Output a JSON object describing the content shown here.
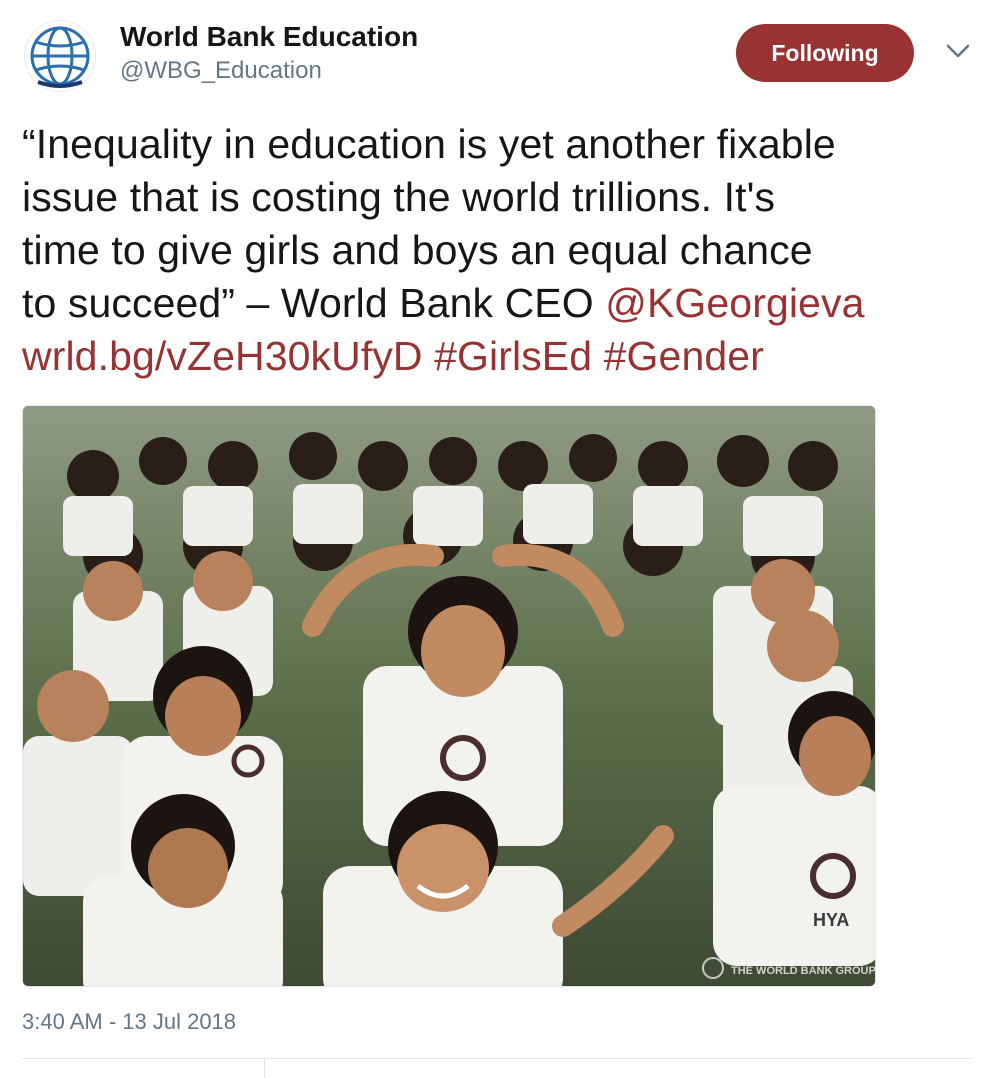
{
  "account": {
    "display_name": "World Bank Education",
    "handle": "@WBG_Education",
    "avatar_icon": "globe-icon",
    "brand_color": "#1a3a6b"
  },
  "follow_button": {
    "label": "Following",
    "color": "#993333"
  },
  "menu": {
    "icon": "chevron-down-icon"
  },
  "tweet": {
    "lines": [
      "“Inequality in education is yet another fixable",
      "issue that is costing the world trillions. It's",
      "time to give girls and boys an equal chance",
      "to succeed” – World Bank CEO "
    ],
    "mention": "@KGeorgieva",
    "url": "wrld.bg/vZeH30kUfyD",
    "hashtags": [
      "#GirlsEd",
      "#Gender"
    ],
    "link_color": "#993333"
  },
  "media": {
    "watermark": "THE WORLD BANK GROUP",
    "shirt_text": "HYA"
  },
  "timestamp": "3:40 AM - 13 Jul 2018"
}
